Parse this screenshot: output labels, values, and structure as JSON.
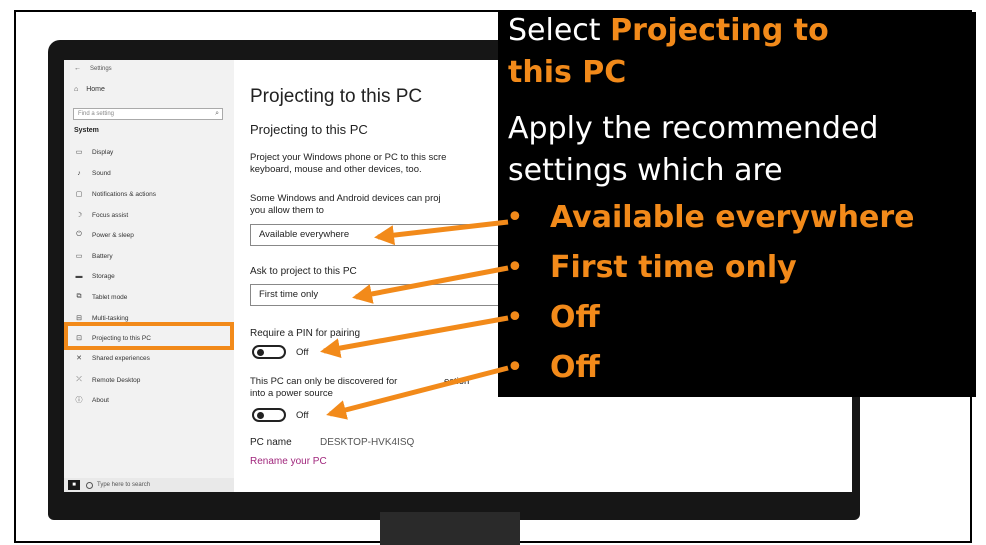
{
  "settings": {
    "window_title": "Settings",
    "back_glyph": "←",
    "home_label": "Home",
    "search_placeholder": "Find a setting",
    "section_label": "System",
    "nav_items": [
      {
        "label": "Display",
        "icon": "display-icon",
        "glyph": "▭"
      },
      {
        "label": "Sound",
        "icon": "sound-icon",
        "glyph": "♪"
      },
      {
        "label": "Notifications & actions",
        "icon": "notifications-icon",
        "glyph": "▢"
      },
      {
        "label": "Focus assist",
        "icon": "moon-icon",
        "glyph": "☽"
      },
      {
        "label": "Power & sleep",
        "icon": "power-icon",
        "glyph": "⏻"
      },
      {
        "label": "Battery",
        "icon": "battery-icon",
        "glyph": "▭"
      },
      {
        "label": "Storage",
        "icon": "storage-icon",
        "glyph": "▬"
      },
      {
        "label": "Tablet mode",
        "icon": "tablet-icon",
        "glyph": "⧉"
      },
      {
        "label": "Multi-tasking",
        "icon": "multitasking-icon",
        "glyph": "⊟"
      },
      {
        "label": "Projecting to this PC",
        "icon": "projecting-icon",
        "glyph": "⊡"
      },
      {
        "label": "Shared experiences",
        "icon": "shared-icon",
        "glyph": "✕"
      },
      {
        "label": "Remote Desktop",
        "icon": "remote-desktop-icon",
        "glyph": "⤫"
      },
      {
        "label": "About",
        "icon": "info-icon",
        "glyph": "ⓘ"
      }
    ],
    "taskbar_search": "Type here to search"
  },
  "content": {
    "page_title": "Projecting to this PC",
    "section_title": "Projecting to this PC",
    "intro_line1": "Project your Windows phone or PC to this scre",
    "intro_line2": "keyboard, mouse and other devices, too.",
    "availability_line1": "Some Windows and Android devices can proj",
    "availability_line2": "you allow them to",
    "availability_value": "Available everywhere",
    "ask_label": "Ask to project to this PC",
    "ask_value": "First time only",
    "pin_label": "Require a PIN for pairing",
    "pin_toggle_text": "Off",
    "power_line1": "This PC can only be discovered for ",
    "power_line1b": "ection",
    "power_line2": "into a power source",
    "power_toggle_text": "Off",
    "pc_name_label": "PC name",
    "pc_name_value": "DESKTOP-HVK4ISQ",
    "rename_link": "Rename your PC"
  },
  "annotation": {
    "line1_prefix": "Select ",
    "line1_highlight": "Projecting to",
    "line2_highlight": "this PC",
    "line3": "Apply the recommended",
    "line4": "settings which are",
    "bullet_glyph": "•",
    "bullets": [
      "Available everywhere",
      "First time only",
      "Off",
      "Off"
    ],
    "accent_color": "#f28a1a"
  }
}
